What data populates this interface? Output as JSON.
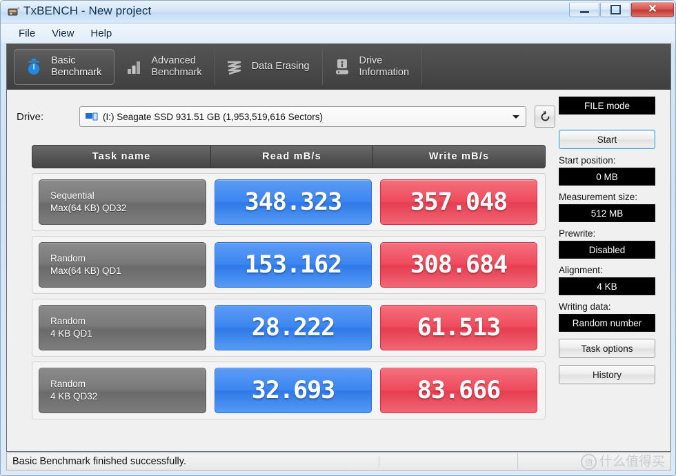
{
  "window": {
    "title": "TxBENCH - New project",
    "icon": "app-icon",
    "buttons": {
      "minimize": "minimize-button",
      "maximize": "maximize-button",
      "close": "✕"
    }
  },
  "menu": {
    "items": [
      {
        "label": "File"
      },
      {
        "label": "View"
      },
      {
        "label": "Help"
      }
    ]
  },
  "tabs": [
    {
      "label": "Basic\nBenchmark",
      "icon": "stopwatch-icon",
      "active": true
    },
    {
      "label": "Advanced\nBenchmark",
      "icon": "bar-chart-icon",
      "active": false
    },
    {
      "label": "Data Erasing",
      "icon": "zigzag-erase-icon",
      "active": false
    },
    {
      "label": "Drive\nInformation",
      "icon": "drive-info-icon",
      "active": false
    }
  ],
  "drive": {
    "label": "Drive:",
    "selected": "(I:) Seagate SSD  931.51 GB (1,953,519,616 Sectors)",
    "icon": "drive-combo-icon",
    "refresh_icon": "refresh-icon"
  },
  "results": {
    "headers": {
      "task": "Task name",
      "read": "Read mB/s",
      "write": "Write mB/s"
    },
    "rows": [
      {
        "name_line1": "Sequential",
        "name_line2": "Max(64 KB) QD32",
        "read": "348.323",
        "write": "357.048"
      },
      {
        "name_line1": "Random",
        "name_line2": "Max(64 KB) QD1",
        "read": "153.162",
        "write": "308.684"
      },
      {
        "name_line1": "Random",
        "name_line2": "4 KB QD1",
        "read": "28.222",
        "write": "61.513"
      },
      {
        "name_line1": "Random",
        "name_line2": "4 KB QD32",
        "read": "32.693",
        "write": "83.666"
      }
    ]
  },
  "sidebar": {
    "mode": "FILE mode",
    "start": "Start",
    "start_position_label": "Start position:",
    "start_position_value": "0 MB",
    "measurement_size_label": "Measurement size:",
    "measurement_size_value": "512 MB",
    "prewrite_label": "Prewrite:",
    "prewrite_value": "Disabled",
    "alignment_label": "Alignment:",
    "alignment_value": "4 KB",
    "writing_data_label": "Writing data:",
    "writing_data_value": "Random number",
    "task_options": "Task options",
    "history": "History"
  },
  "status": {
    "message": "Basic Benchmark finished successfully.",
    "watermark_mark": "值",
    "watermark_text": "什么值得买"
  },
  "colors": {
    "read_blue": "#3b86f0",
    "write_red": "#ef4b5c",
    "tab_bar": "#4a4a4a",
    "header_gray": "#565656"
  }
}
